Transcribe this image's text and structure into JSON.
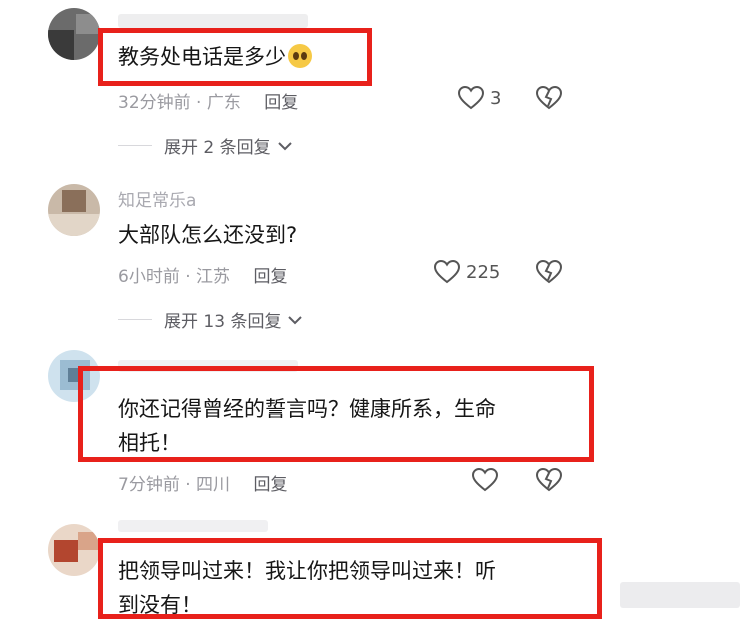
{
  "comments": [
    {
      "username": "",
      "text": "教务处电话是多少",
      "emoji": "crying-face-emoji",
      "time": "32分钟前",
      "location": "广东",
      "reply": "回复",
      "likes": "3",
      "expand": "展开 2 条回复"
    },
    {
      "username": "知足常乐a",
      "text": "大部队怎么还没到?",
      "time": "6小时前",
      "location": "江苏",
      "reply": "回复",
      "likes": "225",
      "expand": "展开 13 条回复"
    },
    {
      "username": "",
      "text_line1": "你还记得曾经的誓言吗？健康所系，生命",
      "text_line2": "相托！",
      "time": "7分钟前",
      "location": "四川",
      "reply": "回复",
      "likes": ""
    },
    {
      "username": "",
      "text_line1": "把领导叫过来！我让你把领导叫过来！听",
      "text_line2": "到没有！"
    }
  ],
  "separator": "·",
  "colors": {
    "highlight": "#e8211b",
    "meta": "#9a9aa0"
  }
}
